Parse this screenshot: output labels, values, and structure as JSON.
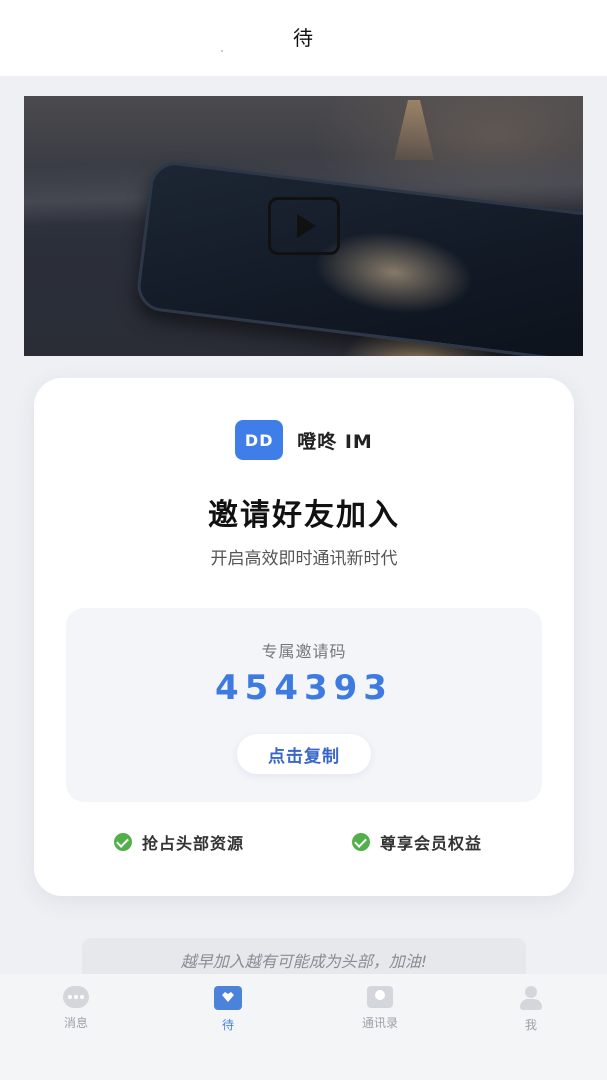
{
  "header": {
    "title": "待"
  },
  "banner": {
    "play_icon": "play-icon"
  },
  "brand": {
    "logo_text": "DD",
    "name": "噔咚 IM",
    "color": "#3f7de8"
  },
  "invite": {
    "title": "邀请好友加入",
    "subtitle": "开启高效即时通讯新时代",
    "code_label": "专属邀请码",
    "code": "454393",
    "copy_label": "点击复制",
    "code_color": "#3e7be0"
  },
  "benefits": [
    {
      "icon": "check-circle-icon",
      "label": "抢占头部资源"
    },
    {
      "icon": "check-circle-icon",
      "label": "尊享会员权益"
    }
  ],
  "tip": "越早加入越有可能成为头部，加油!",
  "nav": {
    "active": "待",
    "items": [
      {
        "label": "消息",
        "icon": "message-icon"
      },
      {
        "label": "待",
        "icon": "heart-box-icon"
      },
      {
        "label": "通讯录",
        "icon": "contacts-icon"
      },
      {
        "label": "我",
        "icon": "user-icon"
      }
    ]
  }
}
